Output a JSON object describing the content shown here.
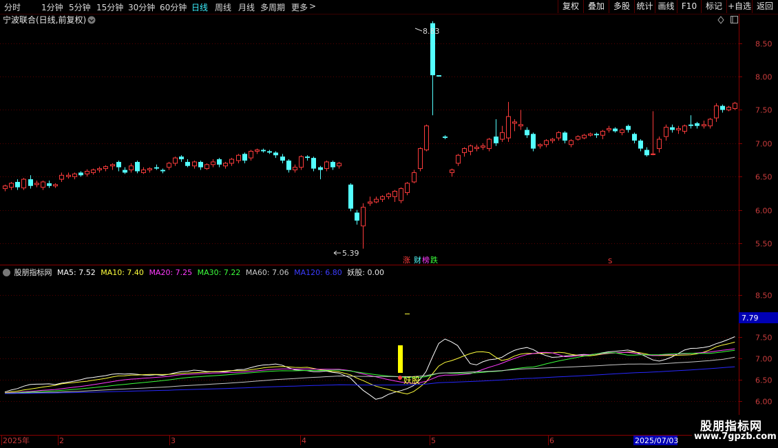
{
  "toolbar": {
    "periods": [
      "分时",
      "1分钟",
      "5分钟",
      "15分钟",
      "30分钟",
      "60分钟",
      "日线",
      "周线",
      "月线",
      "多周期",
      "更多"
    ],
    "more_arrow": ">",
    "active_period": "日线",
    "buttons": [
      "复权",
      "叠加",
      "多股",
      "统计",
      "画线",
      "F10",
      "标记",
      "+自选",
      "返回"
    ]
  },
  "main_panel": {
    "title": "宁波联合(日线,前复权)",
    "y_ticks": [
      "8.50",
      "8.00",
      "7.50",
      "7.00",
      "6.50",
      "6.00",
      "5.50"
    ],
    "high_label": "8.83",
    "low_label": "5.39",
    "markers": {
      "zhang": "涨",
      "cai": "财",
      "bang": "榜",
      "die": "跌",
      "s_mark": "S"
    }
  },
  "indicator_panel": {
    "name": "股朋指标网",
    "ma5": "MA5: 7.52",
    "ma10": "MA10: 7.40",
    "ma20": "MA20: 7.25",
    "ma30": "MA30: 7.22",
    "ma60": "MA60: 7.06",
    "ma120": "MA120: 6.80",
    "yaogu": "妖股: 0.00",
    "y_ticks": [
      "8.50",
      "7.50",
      "7.00",
      "6.50",
      "6.00"
    ],
    "current_value": "7.79",
    "signal_label": "妖股"
  },
  "time_axis": {
    "labels": [
      "2025年",
      "2",
      "3",
      "4",
      "5",
      "6"
    ],
    "current_date": "2025/07/03"
  },
  "watermark": {
    "line1": "股朋指标网",
    "line2": "www.7gpzb.com"
  },
  "colors": {
    "up": "#ff3c3c",
    "down": "#54ffff",
    "ma5": "#ffffff",
    "ma10": "#ffff3c",
    "ma20": "#ff3cff",
    "ma30": "#3cff3c",
    "ma60": "#c8c8c8",
    "ma120": "#2828ff",
    "axis": "#8a0000"
  },
  "chart_data": {
    "type": "candlestick",
    "ylim": [
      5.2,
      8.9
    ],
    "candles": [
      [
        6.32,
        6.36,
        6.28,
        6.38
      ],
      [
        6.34,
        6.4,
        6.3,
        6.42
      ],
      [
        6.42,
        6.34,
        6.3,
        6.46
      ],
      [
        6.33,
        6.46,
        6.3,
        6.48
      ],
      [
        6.46,
        6.36,
        6.32,
        6.52
      ],
      [
        6.38,
        6.4,
        6.34,
        6.44
      ],
      [
        6.34,
        6.42,
        6.3,
        6.44
      ],
      [
        6.4,
        6.36,
        6.33,
        6.44
      ],
      [
        6.36,
        6.38,
        6.33,
        6.4
      ],
      [
        6.46,
        6.52,
        6.42,
        6.56
      ],
      [
        6.5,
        6.52,
        6.47,
        6.56
      ],
      [
        6.5,
        6.54,
        6.46,
        6.56
      ],
      [
        6.56,
        6.52,
        6.5,
        6.58
      ],
      [
        6.54,
        6.58,
        6.5,
        6.61
      ],
      [
        6.56,
        6.6,
        6.53,
        6.62
      ],
      [
        6.6,
        6.62,
        6.56,
        6.65
      ],
      [
        6.62,
        6.65,
        6.58,
        6.67
      ],
      [
        6.66,
        6.68,
        6.6,
        6.7
      ],
      [
        6.72,
        6.64,
        6.58,
        6.74
      ],
      [
        6.6,
        6.56,
        6.54,
        6.64
      ],
      [
        6.6,
        6.66,
        6.56,
        6.7
      ],
      [
        6.72,
        6.58,
        6.55,
        6.74
      ],
      [
        6.56,
        6.6,
        6.54,
        6.64
      ],
      [
        6.6,
        6.62,
        6.56,
        6.64
      ],
      [
        6.64,
        6.62,
        6.6,
        6.68
      ],
      [
        6.6,
        6.58,
        6.55,
        6.62
      ],
      [
        6.64,
        6.7,
        6.6,
        6.72
      ],
      [
        6.7,
        6.78,
        6.66,
        6.8
      ],
      [
        6.8,
        6.76,
        6.72,
        6.82
      ],
      [
        6.72,
        6.66,
        6.64,
        6.76
      ],
      [
        6.66,
        6.72,
        6.62,
        6.74
      ],
      [
        6.72,
        6.64,
        6.6,
        6.74
      ],
      [
        6.62,
        6.68,
        6.6,
        6.7
      ],
      [
        6.68,
        6.72,
        6.64,
        6.76
      ],
      [
        6.76,
        6.68,
        6.64,
        6.78
      ],
      [
        6.66,
        6.7,
        6.62,
        6.72
      ],
      [
        6.7,
        6.76,
        6.66,
        6.78
      ],
      [
        6.74,
        6.82,
        6.7,
        6.84
      ],
      [
        6.84,
        6.74,
        6.7,
        6.86
      ],
      [
        6.78,
        6.88,
        6.74,
        6.9
      ],
      [
        6.88,
        6.9,
        6.84,
        6.92
      ],
      [
        6.9,
        6.88,
        6.86,
        6.92
      ],
      [
        6.88,
        6.86,
        6.84,
        6.9
      ],
      [
        6.86,
        6.82,
        6.78,
        6.88
      ],
      [
        6.8,
        6.74,
        6.7,
        6.84
      ],
      [
        6.74,
        6.6,
        6.56,
        6.76
      ],
      [
        6.6,
        6.64,
        6.56,
        6.68
      ],
      [
        6.64,
        6.8,
        6.6,
        6.82
      ],
      [
        6.8,
        6.78,
        6.74,
        6.82
      ],
      [
        6.78,
        6.62,
        6.58,
        6.8
      ],
      [
        6.64,
        6.6,
        6.46,
        6.66
      ],
      [
        6.62,
        6.72,
        6.58,
        6.74
      ],
      [
        6.72,
        6.64,
        6.6,
        6.74
      ],
      [
        6.66,
        6.7,
        6.62,
        6.72
      ],
      [
        6.38,
        6.02,
        5.98,
        6.4
      ],
      [
        5.96,
        5.84,
        5.78,
        6.0
      ],
      [
        5.76,
        6.04,
        5.42,
        6.1
      ],
      [
        6.1,
        6.12,
        6.06,
        6.2
      ],
      [
        6.12,
        6.16,
        6.1,
        6.2
      ],
      [
        6.16,
        6.2,
        6.12,
        6.22
      ],
      [
        6.2,
        6.24,
        6.16,
        6.26
      ],
      [
        6.2,
        6.28,
        6.12,
        6.3
      ],
      [
        6.14,
        6.32,
        6.1,
        6.34
      ],
      [
        6.26,
        6.4,
        6.22,
        6.42
      ],
      [
        6.42,
        6.56,
        6.4,
        6.6
      ],
      [
        6.62,
        6.92,
        6.58,
        6.94
      ],
      [
        6.9,
        7.26,
        6.88,
        7.28
      ],
      [
        8.8,
        8.02,
        7.42,
        8.83
      ],
      [
        8.02,
        8.0,
        8.0,
        8.02
      ],
      [
        7.1,
        7.08,
        7.06,
        7.12
      ],
      [
        6.56,
        6.6,
        6.5,
        6.62
      ],
      [
        6.7,
        6.82,
        6.66,
        6.84
      ],
      [
        6.86,
        6.92,
        6.8,
        6.94
      ],
      [
        6.88,
        6.96,
        6.82,
        6.98
      ],
      [
        6.92,
        6.94,
        6.88,
        6.98
      ],
      [
        6.94,
        6.96,
        6.9,
        7.0
      ],
      [
        6.92,
        7.06,
        6.88,
        7.08
      ],
      [
        7.1,
        7.0,
        6.96,
        7.36
      ],
      [
        7.06,
        7.16,
        7.02,
        7.26
      ],
      [
        7.08,
        7.4,
        7.02,
        7.62
      ],
      [
        7.3,
        7.32,
        7.18,
        7.36
      ],
      [
        7.26,
        7.28,
        7.2,
        7.5
      ],
      [
        7.2,
        7.12,
        7.08,
        7.24
      ],
      [
        7.14,
        6.92,
        6.88,
        7.16
      ],
      [
        6.96,
        6.98,
        6.92,
        7.0
      ],
      [
        6.98,
        7.04,
        6.94,
        7.06
      ],
      [
        7.04,
        7.06,
        7.0,
        7.08
      ],
      [
        7.08,
        7.16,
        7.04,
        7.18
      ],
      [
        7.16,
        7.04,
        7.0,
        7.18
      ],
      [
        6.98,
        7.04,
        6.94,
        7.06
      ],
      [
        7.06,
        7.1,
        7.04,
        7.12
      ],
      [
        7.08,
        7.12,
        7.06,
        7.14
      ],
      [
        7.12,
        7.14,
        7.1,
        7.16
      ],
      [
        7.14,
        7.12,
        7.08,
        7.16
      ],
      [
        7.12,
        7.18,
        7.06,
        7.2
      ],
      [
        7.2,
        7.22,
        7.16,
        7.26
      ],
      [
        7.22,
        7.18,
        7.16,
        7.24
      ],
      [
        7.16,
        7.2,
        7.12,
        7.22
      ],
      [
        7.26,
        7.2,
        7.16,
        7.28
      ],
      [
        7.14,
        7.04,
        7.0,
        7.16
      ],
      [
        7.04,
        6.92,
        6.88,
        7.06
      ],
      [
        6.9,
        6.82,
        6.8,
        6.94
      ],
      [
        6.84,
        6.84,
        6.82,
        7.48
      ],
      [
        6.92,
        7.06,
        6.86,
        7.1
      ],
      [
        7.1,
        7.24,
        7.04,
        7.28
      ],
      [
        7.24,
        7.2,
        7.16,
        7.28
      ],
      [
        7.2,
        7.22,
        7.14,
        7.26
      ],
      [
        7.18,
        7.26,
        7.14,
        7.28
      ],
      [
        7.28,
        7.26,
        7.22,
        7.42
      ],
      [
        7.3,
        7.26,
        7.22,
        7.32
      ],
      [
        7.26,
        7.28,
        7.22,
        7.34
      ],
      [
        7.26,
        7.36,
        7.22,
        7.38
      ],
      [
        7.38,
        7.56,
        7.32,
        7.6
      ],
      [
        7.56,
        7.5,
        7.46,
        7.58
      ],
      [
        7.5,
        7.54,
        7.48,
        7.56
      ],
      [
        7.52,
        7.6,
        7.5,
        7.62
      ]
    ]
  }
}
